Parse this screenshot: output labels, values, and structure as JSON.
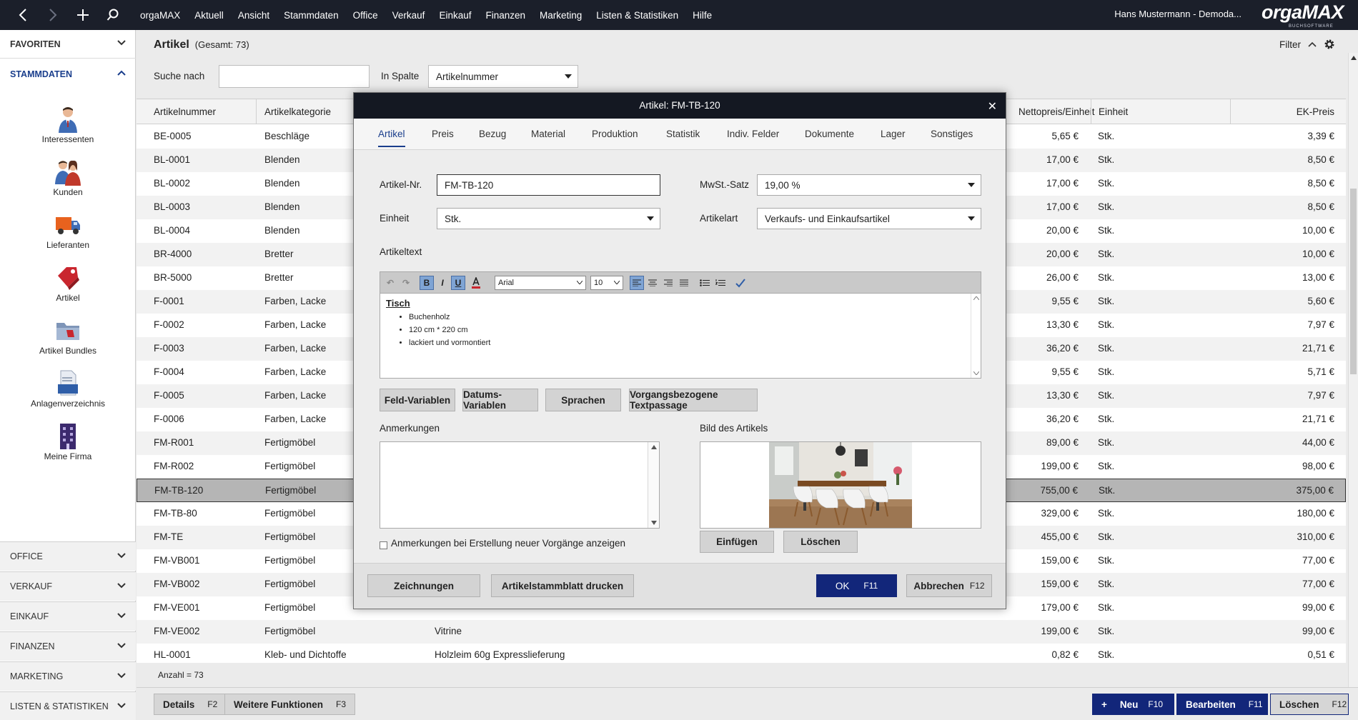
{
  "topbar": {
    "menu": [
      "orgaMAX",
      "Aktuell",
      "Ansicht",
      "Stammdaten",
      "Office",
      "Verkauf",
      "Einkauf",
      "Finanzen",
      "Marketing",
      "Listen & Statistiken",
      "Hilfe"
    ],
    "user": "Hans Mustermann - Demoda...",
    "logo": "orgaMAX",
    "logo_sub": "BUCHSOFTWARE"
  },
  "sidebar": {
    "favoriten": "FAVORITEN",
    "stammdaten": "STAMMDATEN",
    "items": [
      {
        "label": "Interessenten",
        "icon": "person-icon"
      },
      {
        "label": "Kunden",
        "icon": "people-icon"
      },
      {
        "label": "Lieferanten",
        "icon": "truck-icon"
      },
      {
        "label": "Artikel",
        "icon": "tag-icon"
      },
      {
        "label": "Artikel Bundles",
        "icon": "folder-icon"
      },
      {
        "label": "Anlagenverzeichnis",
        "icon": "document-icon"
      },
      {
        "label": "Meine Firma",
        "icon": "building-icon"
      }
    ],
    "sections": [
      "OFFICE",
      "VERKAUF",
      "EINKAUF",
      "FINANZEN",
      "MARKETING",
      "LISTEN & STATISTIKEN"
    ]
  },
  "page": {
    "title": "Artikel",
    "total": "(Gesamt: 73)",
    "filter": "Filter",
    "search_label": "Suche nach",
    "search_value": "",
    "column_label": "In Spalte",
    "column_value": "Artikelnummer",
    "count": "Anzahl = 73"
  },
  "table": {
    "headers": [
      "Artikelnummer",
      "Artikelkategorie",
      "Nettopreis/Einheit",
      "Einheit",
      "EK-Preis"
    ],
    "rows": [
      [
        "BE-0005",
        "Beschläge",
        "",
        "5,65 €",
        "Stk.",
        "3,39 €"
      ],
      [
        "BL-0001",
        "Blenden",
        "",
        "17,00 €",
        "Stk.",
        "8,50 €"
      ],
      [
        "BL-0002",
        "Blenden",
        "",
        "17,00 €",
        "Stk.",
        "8,50 €"
      ],
      [
        "BL-0003",
        "Blenden",
        "",
        "17,00 €",
        "Stk.",
        "8,50 €"
      ],
      [
        "BL-0004",
        "Blenden",
        "",
        "20,00 €",
        "Stk.",
        "10,00 €"
      ],
      [
        "BR-4000",
        "Bretter",
        "",
        "20,00 €",
        "Stk.",
        "10,00 €"
      ],
      [
        "BR-5000",
        "Bretter",
        "",
        "26,00 €",
        "Stk.",
        "13,00 €"
      ],
      [
        "F-0001",
        "Farben, Lacke",
        "",
        "9,55 €",
        "Stk.",
        "5,60 €"
      ],
      [
        "F-0002",
        "Farben, Lacke",
        "",
        "13,30 €",
        "Stk.",
        "7,97 €"
      ],
      [
        "F-0003",
        "Farben, Lacke",
        "",
        "36,20 €",
        "Stk.",
        "21,71 €"
      ],
      [
        "F-0004",
        "Farben, Lacke",
        "",
        "9,55 €",
        "Stk.",
        "5,71 €"
      ],
      [
        "F-0005",
        "Farben, Lacke",
        "",
        "13,30 €",
        "Stk.",
        "7,97 €"
      ],
      [
        "F-0006",
        "Farben, Lacke",
        "",
        "36,20 €",
        "Stk.",
        "21,71 €"
      ],
      [
        "FM-R001",
        "Fertigmöbel",
        "",
        "89,00 €",
        "Stk.",
        "44,00 €"
      ],
      [
        "FM-R002",
        "Fertigmöbel",
        "",
        "199,00 €",
        "Stk.",
        "98,00 €"
      ],
      [
        "FM-TB-120",
        "Fertigmöbel",
        "",
        "755,00 €",
        "Stk.",
        "375,00 €"
      ],
      [
        "FM-TB-80",
        "Fertigmöbel",
        "",
        "329,00 €",
        "Stk.",
        "180,00 €"
      ],
      [
        "FM-TE",
        "Fertigmöbel",
        "",
        "455,00 €",
        "Stk.",
        "310,00 €"
      ],
      [
        "FM-VB001",
        "Fertigmöbel",
        "",
        "159,00 €",
        "Stk.",
        "77,00 €"
      ],
      [
        "FM-VB002",
        "Fertigmöbel",
        "",
        "159,00 €",
        "Stk.",
        "77,00 €"
      ],
      [
        "FM-VE001",
        "Fertigmöbel",
        "",
        "179,00 €",
        "Stk.",
        "99,00 €"
      ],
      [
        "FM-VE002",
        "Fertigmöbel",
        "Vitrine",
        "199,00 €",
        "Stk.",
        "99,00 €"
      ],
      [
        "HL-0001",
        "Kleb- und Dichtoffe",
        "Holzleim 60g Expresslieferung",
        "0,82 €",
        "Stk.",
        "0,51 €"
      ]
    ],
    "selected_row": 15
  },
  "bottombar": {
    "details": "Details",
    "details_key": "F2",
    "weitere": "Weitere Funktionen",
    "weitere_key": "F3",
    "neu": "Neu",
    "neu_key": "F10",
    "bearbeiten": "Bearbeiten",
    "bearbeiten_key": "F11",
    "loeschen": "Löschen",
    "loeschen_key": "F12"
  },
  "dialog": {
    "title": "Artikel: FM-TB-120",
    "tabs": [
      "Artikel",
      "Preis",
      "Bezug",
      "Material",
      "Produktion",
      "Statistik",
      "Indiv. Felder",
      "Dokumente",
      "Lager",
      "Sonstiges"
    ],
    "active_tab": "Artikel",
    "artikelnr_label": "Artikel-Nr.",
    "artikelnr_value": "FM-TB-120",
    "mwst_label": "MwSt.-Satz",
    "mwst_value": "19,00 %",
    "einheit_label": "Einheit",
    "einheit_value": "Stk.",
    "artikelart_label": "Artikelart",
    "artikelart_value": "Verkaufs- und Einkaufsartikel",
    "artikeltext_label": "Artikeltext",
    "editor": {
      "font": "Arial",
      "size": "10",
      "heading": "Tisch",
      "bullets": [
        "Buchenholz",
        "120 cm * 220 cm",
        "lackiert und vormontiert"
      ]
    },
    "var_buttons": [
      "Feld-Variablen",
      "Datums-Variablen",
      "Sprachen",
      "Vorgangsbezogene Textpassage"
    ],
    "anmerkungen_label": "Anmerkungen",
    "anmerkungen_value": "",
    "bild_label": "Bild des Artikels",
    "checkbox_label": "Anmerkungen bei Erstellung neuer Vorgänge anzeigen",
    "einfuegen": "Einfügen",
    "bild_loeschen": "Löschen",
    "zeichnungen": "Zeichnungen",
    "stammblatt": "Artikelstammblatt drucken",
    "ok": "OK",
    "ok_key": "F11",
    "abbrechen": "Abbrechen",
    "abbrechen_key": "F12"
  }
}
